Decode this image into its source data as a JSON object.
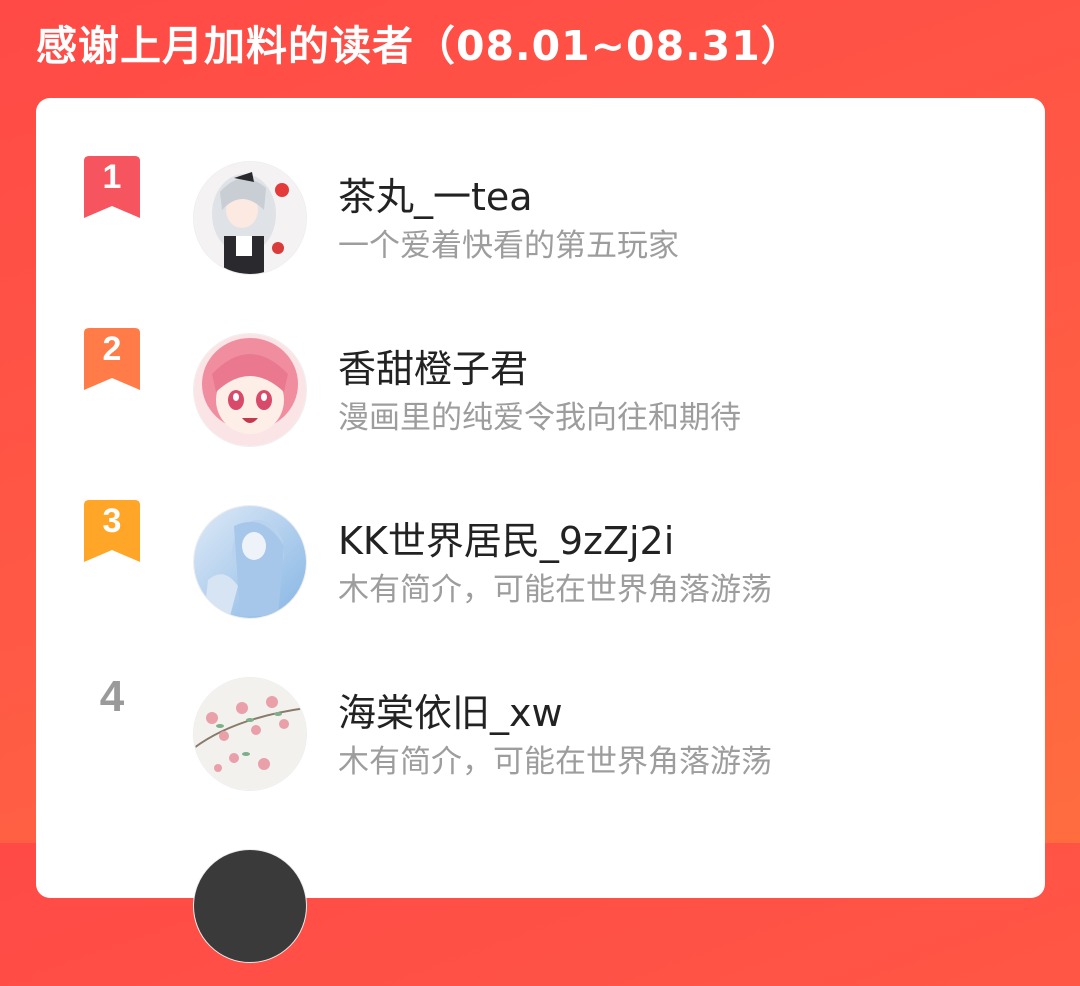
{
  "header": {
    "title": "感谢上月加料的读者（08.01~08.31）"
  },
  "readers": [
    {
      "rank": "1",
      "name": "茶丸_一tea",
      "bio": "一个爱着快看的第五玩家",
      "avatar": "avatar-silver-hair-maid",
      "badge_color": "#f6555f"
    },
    {
      "rank": "2",
      "name": "香甜橙子君",
      "bio": "漫画里的纯爱令我向往和期待",
      "avatar": "avatar-pink-hair-girl",
      "badge_color": "#ff7b48"
    },
    {
      "rank": "3",
      "name": "KK世界居民_9zZj2i",
      "bio": "木有简介，可能在世界角落游荡",
      "avatar": "avatar-blue-anime-figure",
      "badge_color": "#ffa629"
    },
    {
      "rank": "4",
      "name": "海棠依旧_xw",
      "bio": "木有简介，可能在世界角落游荡",
      "avatar": "avatar-begonia-flowers",
      "badge_color": "#9a9a9a"
    }
  ]
}
